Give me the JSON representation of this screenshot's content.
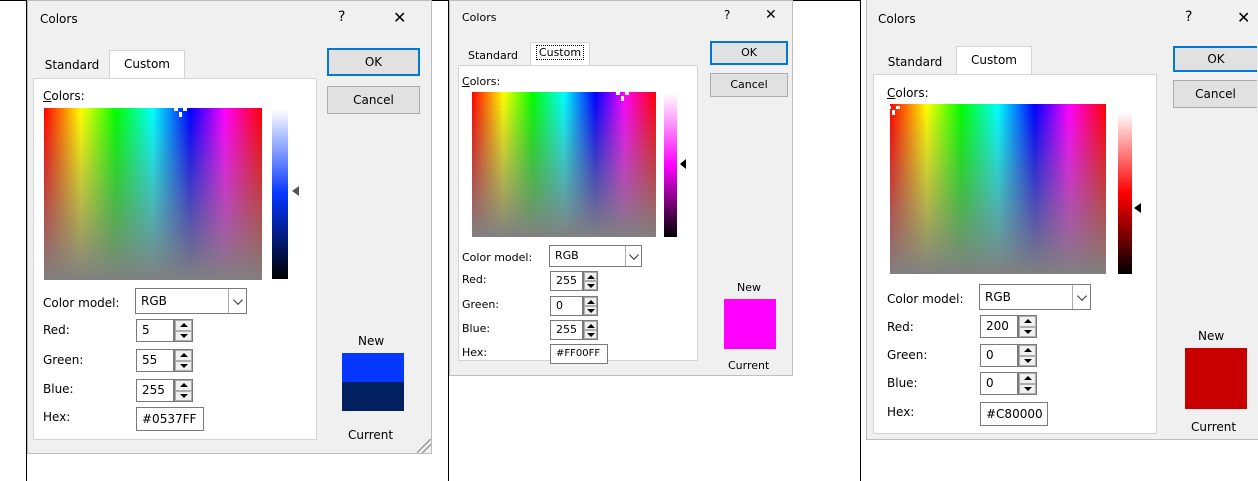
{
  "dialogs": [
    {
      "title": "Colors",
      "help": "?",
      "close": "✕",
      "tabs": [
        "Standard",
        "Custom"
      ],
      "active_tab": "Custom",
      "ok": "OK",
      "cancel": "Cancel",
      "colors_label": "Colors:",
      "color_model_label": "Color model:",
      "color_model_value": "RGB",
      "red_label": "Red:",
      "green_label": "Green:",
      "blue_label": "Blue:",
      "hex_label": "Hex:",
      "red": "5",
      "green": "55",
      "blue": "255",
      "hex": "#0537FF",
      "new_label": "New",
      "current_label": "Current",
      "new_color": "#0537ff",
      "current_color": "#002060"
    },
    {
      "title": "Colors",
      "help": "?",
      "close": "✕",
      "tabs": [
        "Standard",
        "Custom"
      ],
      "active_tab": "Custom",
      "ok": "OK",
      "cancel": "Cancel",
      "colors_label": "Colors:",
      "color_model_label": "Color model:",
      "color_model_value": "RGB",
      "red_label": "Red:",
      "green_label": "Green:",
      "blue_label": "Blue:",
      "hex_label": "Hex:",
      "red": "255",
      "green": "0",
      "blue": "255",
      "hex": "#FF00FF",
      "new_label": "New",
      "current_label": "Current",
      "new_color": "#ff00ff"
    },
    {
      "title": "Colors",
      "help": "?",
      "close": "✕",
      "tabs": [
        "Standard",
        "Custom"
      ],
      "active_tab": "Custom",
      "ok": "OK",
      "cancel": "Cancel",
      "colors_label": "Colors:",
      "color_model_label": "Color model:",
      "color_model_value": "RGB",
      "red_label": "Red:",
      "green_label": "Green:",
      "blue_label": "Blue:",
      "hex_label": "Hex:",
      "red": "200",
      "green": "0",
      "blue": "0",
      "hex": "#C80000",
      "new_label": "New",
      "current_label": "Current",
      "new_color": "#c80000"
    }
  ]
}
